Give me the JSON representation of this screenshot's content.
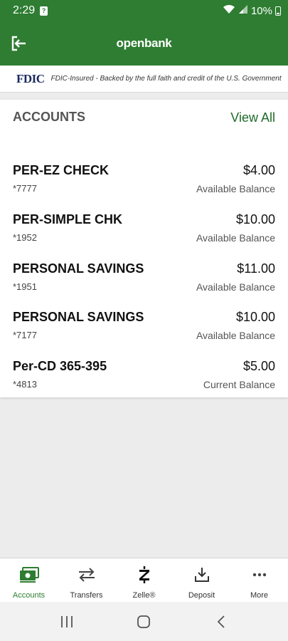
{
  "status_bar": {
    "time": "2:29",
    "notification_badge": "?",
    "battery": "10%"
  },
  "header": {
    "brand": "openbank",
    "icons": {
      "logout": "logout-icon"
    }
  },
  "fdic": {
    "logo": "FDIC",
    "text": "FDIC-Insured - Backed by the full faith and credit of the U.S. Government"
  },
  "accounts": {
    "title": "ACCOUNTS",
    "view_all": "View All",
    "items": [
      {
        "name": "PER-EZ CHECK",
        "number": "*7777",
        "amount": "$4.00",
        "balance_label": "Available Balance"
      },
      {
        "name": "PER-SIMPLE CHK",
        "number": "*1952",
        "amount": "$10.00",
        "balance_label": "Available Balance"
      },
      {
        "name": "PERSONAL SAVINGS",
        "number": "*1951",
        "amount": "$11.00",
        "balance_label": "Available Balance"
      },
      {
        "name": "PERSONAL SAVINGS",
        "number": "*7177",
        "amount": "$10.00",
        "balance_label": "Available Balance"
      },
      {
        "name": "Per-CD 365-395",
        "number": "*4813",
        "amount": "$5.00",
        "balance_label": "Current Balance"
      }
    ]
  },
  "bottom_nav": [
    {
      "label": "Accounts",
      "icon": "accounts-icon",
      "active": true
    },
    {
      "label": "Transfers",
      "icon": "transfers-icon",
      "active": false
    },
    {
      "label": "Zelle®",
      "icon": "zelle-icon",
      "active": false
    },
    {
      "label": "Deposit",
      "icon": "deposit-icon",
      "active": false
    },
    {
      "label": "More",
      "icon": "more-icon",
      "active": false
    }
  ],
  "colors": {
    "brand_green": "#2e7d32",
    "link_green": "#1e6b2a",
    "fdic_navy": "#1a2a5e"
  }
}
